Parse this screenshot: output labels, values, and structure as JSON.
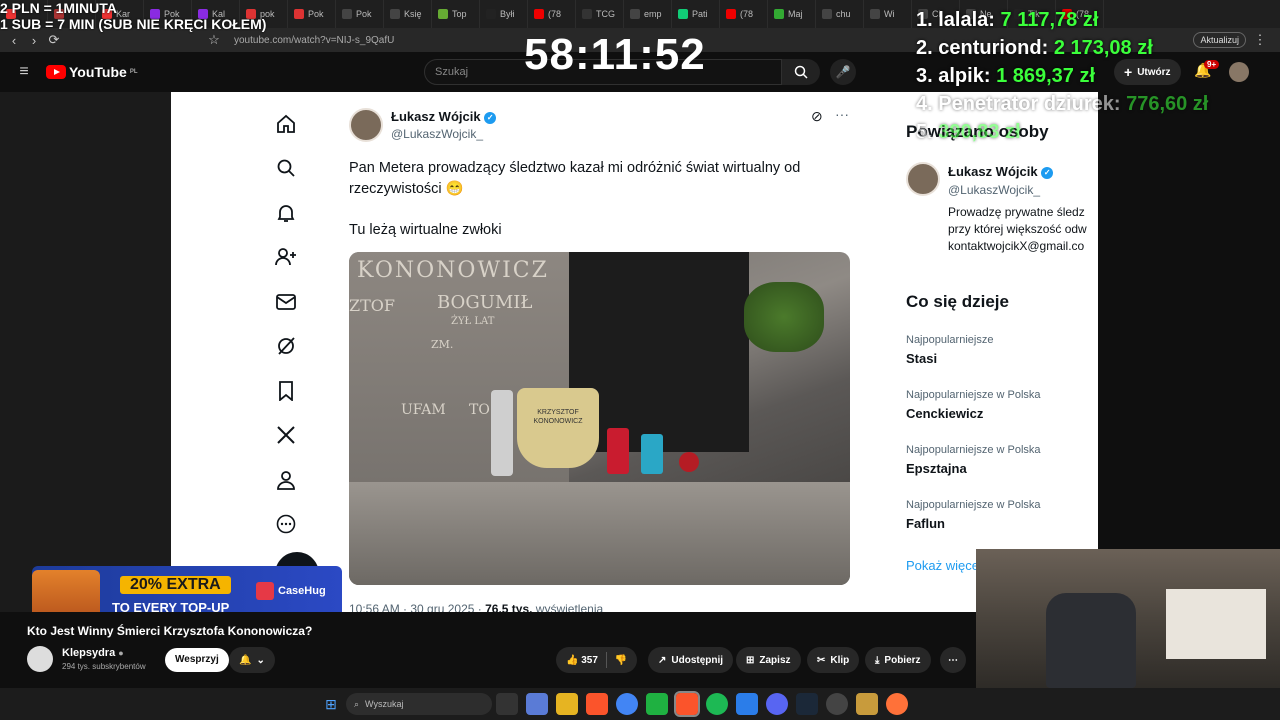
{
  "browser": {
    "tabs": [
      "",
      "",
      "Kar",
      "Pok",
      "Kal",
      "pok",
      "Pok",
      "Pok",
      "Księ",
      "Top",
      "Byłi",
      "(78",
      "TCG",
      "emp",
      "Pati",
      "(78",
      "Maj",
      "chu",
      "Wi",
      "Ci",
      "Ne",
      "Tik",
      "(78"
    ],
    "url": "youtube.com/watch?v=NIJ-s_9QafU",
    "update_button": "Aktualizuj"
  },
  "youtube": {
    "logo_text": "YouTube",
    "logo_region": "PL",
    "search_placeholder": "Szukaj",
    "create_button": "Utwórz",
    "notif_count": "9+"
  },
  "overlay": {
    "promo_line1": "2 PLN = 1MINUTA",
    "promo_line2": "1 SUB = 7 MIN (SUB NIE KRĘCI KOŁEM)",
    "timer": "58:11:52",
    "leaderboard": [
      {
        "rank": "1.",
        "name": "lalala:",
        "amount": "7 117,78 zł"
      },
      {
        "rank": "2.",
        "name": "centuriond:",
        "amount": "2 173,08 zł"
      },
      {
        "rank": "3.",
        "name": "alpik:",
        "amount": "1 869,37 zł"
      },
      {
        "rank": "4.",
        "name": "Penetrator dziurek:",
        "amount": "776,60 zł"
      },
      {
        "rank": "5.",
        "name": "",
        "amount": "390,83 zł"
      }
    ]
  },
  "tweet": {
    "author": "Łukasz Wójcik",
    "handle": "@LukaszWojcik_",
    "text1": "Pan Metera prowadzący śledztwo kazał mi odróżnić świat wirtualny od rzeczywistości 😁",
    "text2": "Tu leżą wirtualne zwłoki",
    "meta_time": "10:56 AM · 30 gru 2025 · ",
    "meta_views": "76,5 tys.",
    "meta_views_label": " wyświetlenia",
    "image_texts": [
      "KONONOWICZ",
      "ZTOF",
      "BOGUMIŁ",
      "ŻYŁ LAT",
      "ZM.",
      "UFAM",
      "TO",
      "KRZYSZTOF",
      "KONONOWICZ"
    ]
  },
  "x_sidebar": {
    "related_title": "Powiązano osoby",
    "related_author": "Łukasz Wójcik",
    "related_handle": "@LukaszWojcik_",
    "related_bio": "Prowadzę prywatne śledz przy której większość odw kontaktwojcikX@gmail.co",
    "trending_title": "Co się dzieje",
    "trends": [
      {
        "label": "Najpopularniejsze",
        "name": "Stasi"
      },
      {
        "label": "Najpopularniejsze w Polska",
        "name": "Cenckiewicz"
      },
      {
        "label": "Najpopularniejsze w Polska",
        "name": "Epsztajna"
      },
      {
        "label": "Najpopularniejsze w Polska",
        "name": "Faflun"
      }
    ],
    "show_more": "Pokaż więce"
  },
  "ad": {
    "headline": "20% EXTRA",
    "subline": "TO EVERY TOP-UP",
    "brand": "CaseHug"
  },
  "video": {
    "title": "Kto Jest Winny Śmierci Krzysztofa Kononowicza?",
    "channel": "Klepsydra",
    "subs": "294 tys. subskrybentów",
    "support_button": "Wesprzyj",
    "likes": "357",
    "share": "Udostępnij",
    "save": "Zapisz",
    "clip": "Klip",
    "download": "Pobierz"
  },
  "taskbar": {
    "search_placeholder": "Wyszukaj"
  },
  "colors": {
    "leaderboard_amount": "#3bff3b",
    "youtube_red": "#ff0000",
    "x_blue": "#1d9bf0"
  }
}
